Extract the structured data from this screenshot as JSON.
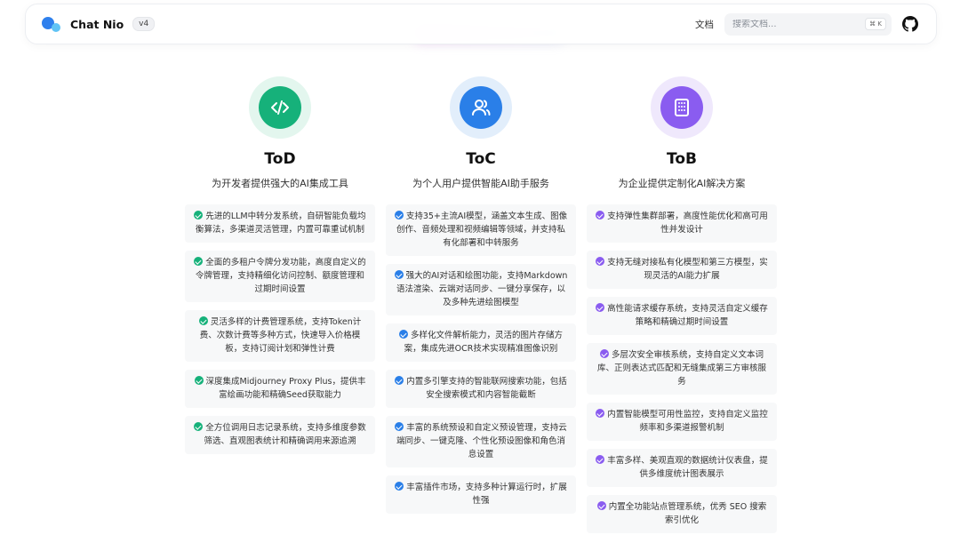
{
  "colors": {
    "tod": "#16b17a",
    "tod_halo": "#e3f6ee",
    "toc": "#2a7fe8",
    "toc_halo": "#e2eefb",
    "tob": "#8a5cf0",
    "tob_halo": "#efe8fc"
  },
  "header": {
    "brand": "Chat Nio",
    "version": "v4",
    "docs_link": "文档",
    "search_placeholder": "搜索文档...",
    "shortcut": "⌘ K",
    "logo_icon": "chatnio-logo-icon",
    "github_icon": "github-icon"
  },
  "columns": [
    {
      "title": "ToD",
      "subtitle": "为开发者提供强大的AI集成工具",
      "icon": "code-icon",
      "features": [
        "先进的LLM中转分发系统，自研智能负载均衡算法，多渠道灵活管理，内置可靠重试机制",
        "全面的多租户令牌分发功能，高度自定义的令牌管理，支持精细化访问控制、额度管理和过期时间设置",
        "灵活多样的计费管理系统，支持Token计费、次数计费等多种方式，快速导入价格模板，支持订阅计划和弹性计费",
        "深度集成Midjourney Proxy Plus，提供丰富绘画功能和精确Seed获取能力",
        "全方位调用日志记录系统，支持多维度参数筛选、直观图表统计和精确调用来源追溯"
      ]
    },
    {
      "title": "ToC",
      "subtitle": "为个人用户提供智能AI助手服务",
      "icon": "users-icon",
      "features": [
        "支持35+主流AI模型，涵盖文本生成、图像创作、音频处理和视频编辑等领域，并支持私有化部署和中转服务",
        "强大的AI对话和绘图功能，支持Markdown语法渲染、云端对话同步、一键分享保存，以及多种先进绘图模型",
        "多样化文件解析能力，灵活的图片存储方案，集成先进OCR技术实现精准图像识别",
        "内置多引擎支持的智能联网搜索功能，包括安全搜索模式和内容智能截断",
        "丰富的系统预设和自定义预设管理，支持云端同步、一键克隆、个性化预设图像和角色消息设置",
        "丰富插件市场，支持多种计算运行时，扩展性强"
      ]
    },
    {
      "title": "ToB",
      "subtitle": "为企业提供定制化AI解决方案",
      "icon": "building-icon",
      "features": [
        "支持弹性集群部署，高度性能优化和高可用性并发设计",
        "支持无缝对接私有化模型和第三方模型，实现灵活的AI能力扩展",
        "高性能请求缓存系统，支持灵活自定义缓存策略和精确过期时间设置",
        "多层次安全审核系统，支持自定义文本词库、正则表达式匹配和无缝集成第三方审核服务",
        "内置智能模型可用性监控，支持自定义监控频率和多渠道报警机制",
        "丰富多样、美观直观的数据统计仪表盘，提供多维度统计图表展示",
        "内置全功能站点管理系统，优秀 SEO 搜索索引优化"
      ]
    }
  ]
}
